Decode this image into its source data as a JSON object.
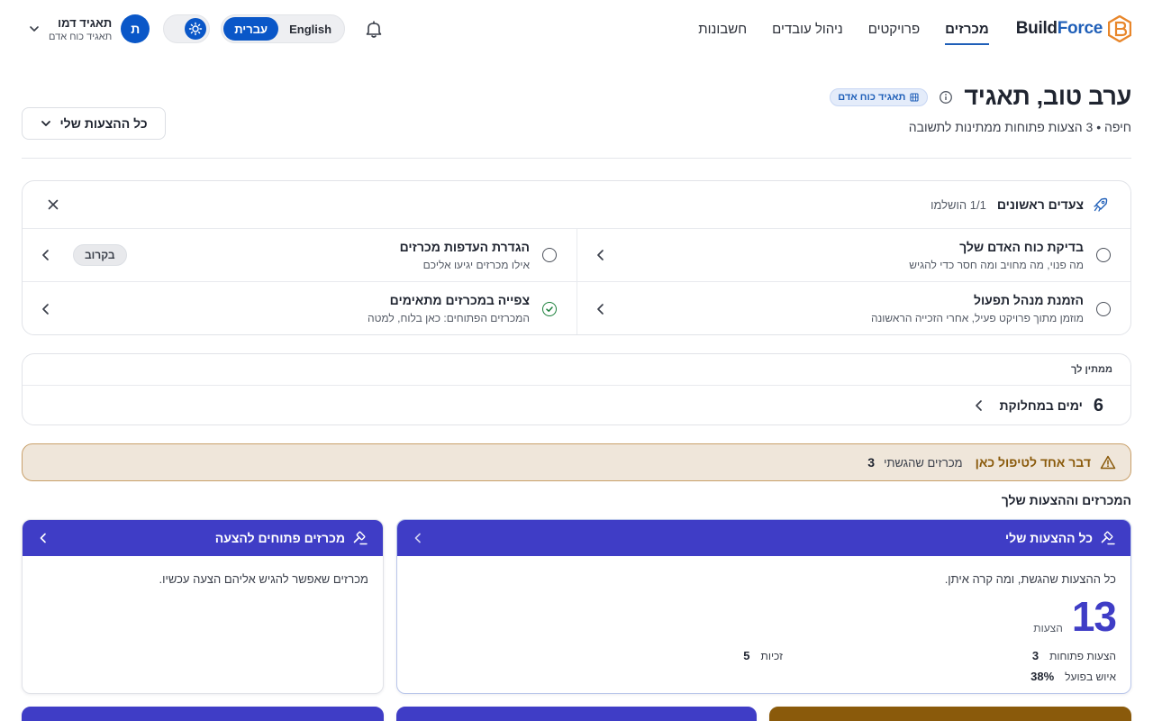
{
  "brand": {
    "name_part1": "Build",
    "name_part2": "Force",
    "logo_icon": "buildforce-hex-logo-icon",
    "colors": {
      "primary": "#1f5fb8",
      "accent_orange": "#e8862a",
      "tile_header": "#3f3dc6",
      "alert_bg": "#efe6da",
      "alert_border": "#c9a06a"
    }
  },
  "nav": {
    "links": [
      {
        "label": "מכרזים",
        "active": true
      },
      {
        "label": "פרויקטים",
        "active": false
      },
      {
        "label": "ניהול עובדים",
        "active": false
      },
      {
        "label": "חשבונות",
        "active": false
      }
    ]
  },
  "user": {
    "initial": "ת",
    "name": "תאגיד דמו",
    "org": "תאגיד כוח אדם"
  },
  "lang": {
    "english": "English",
    "hebrew": "עברית",
    "active": "עברית"
  },
  "theme": {
    "mode_icon": "sun-icon"
  },
  "greeting": {
    "title": "ערב טוב, תאגיד",
    "badge": "תאגיד כוח אדם",
    "subtitle": "חיפה • 3 הצעות פתוחות ממתינות לתשובה"
  },
  "offers_dropdown": {
    "label": "כל ההצעות שלי"
  },
  "onboarding": {
    "title": "צעדים ראשונים",
    "progress": "1/1 הושלמו",
    "steps": [
      {
        "title": "בדיקת כוח האדם שלך",
        "desc": "מה פנוי, מה מחויב ומה חסר כדי להגיש",
        "done": false,
        "pill": ""
      },
      {
        "title": "הגדרת העדפות מכרזים",
        "desc": "אילו מכרזים יגיעו אליכם",
        "done": false,
        "pill": "בקרוב"
      },
      {
        "title": "הזמנת מנהל תפעול",
        "desc": "מוזמן מתוך פרויקט פעיל, אחרי הזכייה הראשונה",
        "done": false,
        "pill": ""
      },
      {
        "title": "צפייה במכרזים מתאימים",
        "desc": "המכרזים הפתוחים: כאן בלוח, למטה",
        "done": true,
        "pill": ""
      }
    ]
  },
  "waiting": {
    "title": "ממתין לך",
    "count": "6",
    "label": "ימים במחלוקת"
  },
  "alert": {
    "title": "דבר אחד לטיפול כאן",
    "text": "מכרזים שהגשתי",
    "count": "3"
  },
  "section": {
    "title": "המכרזים וההצעות שלך"
  },
  "tiles": {
    "my_offers": {
      "title": "כל ההצעות שלי",
      "desc": "כל ההצעות שהגשת, ומה קרה איתן.",
      "big_num": "13",
      "big_label": "הצעות",
      "stats": [
        {
          "label": "הצעות פתוחות",
          "value": "3"
        },
        {
          "label": "זכיות",
          "value": "5"
        },
        {
          "label": "איוש בפועל",
          "value": "38%"
        }
      ]
    },
    "open_tenders": {
      "title": "מכרזים פתוחים להצעה",
      "desc": "מכרזים שאפשר להגיש אליהם הצעה עכשיו."
    }
  }
}
